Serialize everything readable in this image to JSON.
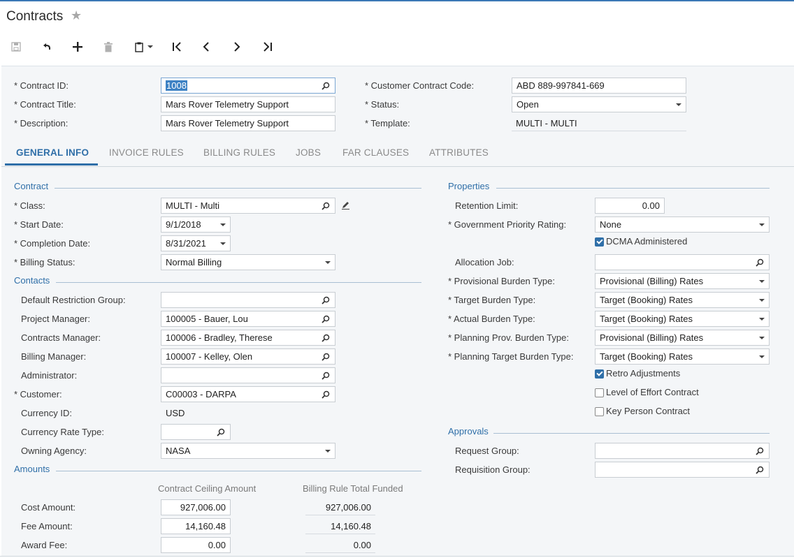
{
  "header": {
    "title": "Contracts"
  },
  "summary": {
    "contract_id": {
      "label": "* Contract ID:",
      "value": "1008"
    },
    "contract_title": {
      "label": "* Contract Title:",
      "value": "Mars Rover Telemetry Support"
    },
    "description": {
      "label": "* Description:",
      "value": "Mars Rover Telemetry Support"
    },
    "customer_contract_code": {
      "label": "* Customer Contract Code:",
      "value": "ABD 889-997841-669"
    },
    "status": {
      "label": "* Status:",
      "value": "Open"
    },
    "template": {
      "label": "* Template:",
      "value": "MULTI - MULTI"
    }
  },
  "tabs": [
    "GENERAL INFO",
    "INVOICE RULES",
    "BILLING RULES",
    "JOBS",
    "FAR CLAUSES",
    "ATTRIBUTES"
  ],
  "contract_section": {
    "title": "Contract",
    "class": {
      "label": "* Class:",
      "value": "MULTI - Multi"
    },
    "start_date": {
      "label": "* Start Date:",
      "value": "9/1/2018"
    },
    "completion_date": {
      "label": "* Completion Date:",
      "value": "8/31/2021"
    },
    "billing_status": {
      "label": "* Billing Status:",
      "value": "Normal Billing"
    }
  },
  "contacts_section": {
    "title": "Contacts",
    "default_restriction_group": {
      "label": "Default Restriction Group:",
      "value": ""
    },
    "project_manager": {
      "label": "Project Manager:",
      "value": "100005 - Bauer, Lou"
    },
    "contracts_manager": {
      "label": "Contracts Manager:",
      "value": "100006 - Bradley, Therese"
    },
    "billing_manager": {
      "label": "Billing Manager:",
      "value": "100007 - Kelley, Olen"
    },
    "administrator": {
      "label": "Administrator:",
      "value": ""
    },
    "customer": {
      "label": "* Customer:",
      "value": "C00003 - DARPA"
    },
    "currency_id": {
      "label": "Currency ID:",
      "value": "USD"
    },
    "currency_rate_type": {
      "label": "Currency Rate Type:",
      "value": ""
    },
    "owning_agency": {
      "label": "Owning Agency:",
      "value": "NASA"
    }
  },
  "amounts_section": {
    "title": "Amounts",
    "col_ceiling": "Contract Ceiling Amount",
    "col_funded": "Billing Rule Total Funded",
    "cost_amount": {
      "label": "Cost Amount:",
      "ceiling": "927,006.00",
      "funded": "927,006.00"
    },
    "fee_amount": {
      "label": "Fee Amount:",
      "ceiling": "14,160.48",
      "funded": "14,160.48"
    },
    "award_fee": {
      "label": "Award Fee:",
      "ceiling": "0.00",
      "funded": "0.00"
    }
  },
  "properties_section": {
    "title": "Properties",
    "retention_limit": {
      "label": "Retention Limit:",
      "value": "0.00"
    },
    "gov_priority_rating": {
      "label": "* Government Priority Rating:",
      "value": "None"
    },
    "dcma_administered": {
      "label": "DCMA Administered",
      "checked": true
    },
    "allocation_job": {
      "label": "Allocation Job:",
      "value": ""
    },
    "provisional_burden_type": {
      "label": "* Provisional Burden Type:",
      "value": "Provisional (Billing) Rates"
    },
    "target_burden_type": {
      "label": "* Target Burden Type:",
      "value": "Target (Booking) Rates"
    },
    "actual_burden_type": {
      "label": "* Actual Burden Type:",
      "value": "Target (Booking) Rates"
    },
    "planning_prov_burden_type": {
      "label": "* Planning Prov. Burden Type:",
      "value": "Provisional (Billing) Rates"
    },
    "planning_target_burden_type": {
      "label": "* Planning Target Burden Type:",
      "value": "Target (Booking) Rates"
    },
    "retro_adjustments": {
      "label": "Retro Adjustments",
      "checked": true
    },
    "level_of_effort": {
      "label": "Level of Effort Contract",
      "checked": false
    },
    "key_person": {
      "label": "Key Person Contract",
      "checked": false
    }
  },
  "approvals_section": {
    "title": "Approvals",
    "request_group": {
      "label": "Request Group:",
      "value": ""
    },
    "requisition_group": {
      "label": "Requisition Group:",
      "value": ""
    }
  },
  "colors": {
    "accent": "#2f6fa8",
    "panel_bg": "#f4f6f8",
    "border": "#c8cdd2"
  }
}
